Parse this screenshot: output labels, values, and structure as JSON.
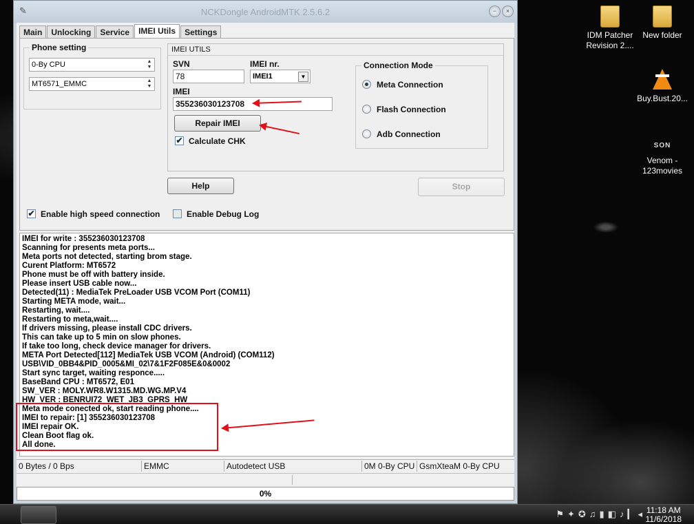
{
  "window": {
    "title": "NCKDongle AndroidMTK 2.5.6.2",
    "tabs": [
      "Main",
      "Unlocking",
      "Service",
      "IMEI Utils",
      "Settings"
    ],
    "active_tab": "IMEI Utils"
  },
  "phone_setting": {
    "label": "Phone setting",
    "cpu_select": "0-By CPU",
    "model_select": "MT6571_EMMC"
  },
  "imei_utils": {
    "label": "IMEI UTILS",
    "svn_label": "SVN",
    "svn_value": "78",
    "imei_nr_label": "IMEI nr.",
    "imei_nr_value": "IMEI1",
    "imei_label": "IMEI",
    "imei_value": "355236030123708",
    "repair_button": "Repair IMEI",
    "calc_chk_label": "Calculate CHK",
    "calc_chk_checked": true
  },
  "connection_mode": {
    "label": "Connection Mode",
    "options": [
      "Meta Connection",
      "Flash Connection",
      "Adb Connection"
    ],
    "selected": "Meta Connection"
  },
  "buttons": {
    "help": "Help",
    "stop": "Stop"
  },
  "options": {
    "high_speed_label": "Enable high speed connection",
    "high_speed_checked": true,
    "debug_log_label": "Enable Debug Log",
    "debug_log_checked": false
  },
  "log_lines": [
    "IMEI for write : 355236030123708",
    "Scanning for presents meta ports...",
    "Meta ports not detected, starting brom stage.",
    "Curent Platform: MT6572",
    "Phone must be off with battery inside.",
    "Please insert USB cable now...",
    "Detected(11) : MediaTek PreLoader USB VCOM Port (COM11)",
    "Starting META mode, wait...",
    "Restarting, wait....",
    "Restarting to meta,wait....",
    "If drivers missing, please install CDC drivers.",
    "This can take up to 5 min on slow phones.",
    "If take too long, check device manager for drivers.",
    "META Port Detected[112] MediaTek USB VCOM (Android) (COM112)",
    "USB\\VID_0BB4&PID_0005&MI_02\\7&1F2F085E&0&0002",
    "Start sync target, waiting responce.....",
    "BaseBand CPU : MT6572, E01",
    "SW_VER : MOLY.WR8.W1315.MD.WG.MP.V4",
    "HW_VER : BENRUI72_WET_JB3_GPRS_HW",
    "Meta mode conected ok, start reading phone....",
    "IMEI to repair: [1] 355236030123708",
    "IMEI repair OK.",
    "Clean Boot flag ok.",
    "All done."
  ],
  "status_bar": {
    "bytes": "0 Bytes / 0 Bps",
    "storage": "EMMC",
    "usb": "Autodetect USB",
    "cpu": "0M 0-By CPU",
    "team": "GsmXteaM 0-By CPU"
  },
  "progress": {
    "value": 0,
    "label": "0%"
  },
  "desktop_icons": {
    "idm": "IDM Patcher Revision 2....",
    "new_folder": "New folder",
    "vlc": "Buy.Bust.20...",
    "venom_logo": "SON",
    "venom": "Venom - 123movies"
  },
  "clock": {
    "time": "11:18 AM",
    "date": "11/6/2018"
  },
  "colors": {
    "annotation": "#e0101a",
    "window_frame": "#c9d4df"
  }
}
